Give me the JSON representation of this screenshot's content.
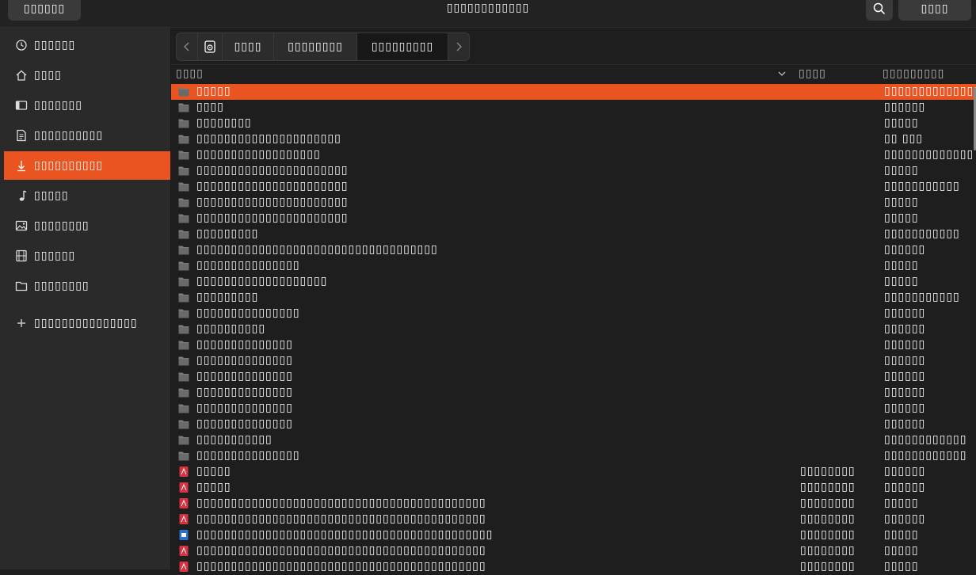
{
  "header": {
    "cancel_label": "▯▯▯▯▯▯",
    "title": "▯▯▯▯▯▯▯▯▯▯▯▯",
    "open_label": "▯▯▯▯",
    "search_icon": "search-icon"
  },
  "sidebar": {
    "items": [
      {
        "label": "▯▯▯▯▯▯",
        "icon": "clock-icon"
      },
      {
        "label": "▯▯▯▯",
        "icon": "home-icon"
      },
      {
        "label": "▯▯▯▯▯▯▯",
        "icon": "desktop-icon"
      },
      {
        "label": "▯▯▯▯▯▯▯▯▯▯",
        "icon": "document-icon"
      },
      {
        "label": "▯▯▯▯▯▯▯▯▯▯",
        "icon": "download-icon",
        "active": true
      },
      {
        "label": "▯▯▯▯▯",
        "icon": "music-icon"
      },
      {
        "label": "▯▯▯▯▯▯▯▯",
        "icon": "picture-icon"
      },
      {
        "label": "▯▯▯▯▯▯",
        "icon": "video-icon"
      },
      {
        "label": "▯▯▯▯▯▯▯▯",
        "icon": "folder-icon"
      }
    ],
    "add_label": "▯▯▯▯▯▯▯▯▯▯▯▯▯▯▯"
  },
  "pathbar": {
    "segments": [
      "▯▯▯▯",
      "▯▯▯▯▯▯▯▯",
      "▯▯▯▯▯▯▯▯▯"
    ]
  },
  "columns": {
    "name": "▯▯▯▯",
    "size": "▯▯▯▯",
    "modified": "▯▯▯▯▯▯▯▯▯"
  },
  "files": [
    {
      "name": "▯▯▯▯▯",
      "size": "",
      "modified": "▯▯▯▯▯▯▯▯▯▯▯▯▯▯",
      "type": "folder"
    },
    {
      "name": "▯▯▯▯",
      "size": "",
      "modified": "▯▯▯▯▯▯",
      "type": "folder"
    },
    {
      "name": "▯▯▯▯▯▯▯▯",
      "size": "",
      "modified": "▯▯▯▯▯",
      "type": "folder"
    },
    {
      "name": "▯▯▯▯▯▯▯▯▯▯▯▯▯▯▯▯▯▯▯▯▯",
      "size": "",
      "modified": "▯▯ ▯▯▯",
      "type": "folder"
    },
    {
      "name": "▯▯▯▯▯▯▯▯▯▯▯▯▯▯▯▯▯▯",
      "size": "",
      "modified": "▯▯▯▯▯▯▯▯▯▯▯▯▯",
      "type": "folder"
    },
    {
      "name": "▯▯▯▯▯▯▯▯▯▯▯▯▯▯▯▯▯▯▯▯▯▯",
      "size": "",
      "modified": "▯▯▯▯▯",
      "type": "folder"
    },
    {
      "name": "▯▯▯▯▯▯▯▯▯▯▯▯▯▯▯▯▯▯▯▯▯▯",
      "size": "",
      "modified": "▯▯▯▯▯▯▯▯▯▯▯",
      "type": "folder"
    },
    {
      "name": "▯▯▯▯▯▯▯▯▯▯▯▯▯▯▯▯▯▯▯▯▯▯",
      "size": "",
      "modified": "▯▯▯▯▯",
      "type": "folder"
    },
    {
      "name": "▯▯▯▯▯▯▯▯▯▯▯▯▯▯▯▯▯▯▯▯▯▯",
      "size": "",
      "modified": "▯▯▯▯▯",
      "type": "folder"
    },
    {
      "name": "▯▯▯▯▯▯▯▯▯",
      "size": "",
      "modified": "▯▯▯▯▯▯▯▯▯▯▯",
      "type": "folder"
    },
    {
      "name": "▯▯▯▯▯▯▯▯▯▯▯▯▯▯▯▯▯▯▯▯▯▯▯▯▯▯▯▯▯▯▯▯▯▯▯",
      "size": "",
      "modified": "▯▯▯▯▯▯",
      "type": "folder"
    },
    {
      "name": "▯▯▯▯▯▯▯▯▯▯▯▯▯▯▯",
      "size": "",
      "modified": "▯▯▯▯▯",
      "type": "folder"
    },
    {
      "name": "▯▯▯▯▯▯▯▯▯▯▯▯▯▯▯▯▯▯▯",
      "size": "",
      "modified": "▯▯▯▯▯",
      "type": "folder"
    },
    {
      "name": "▯▯▯▯▯▯▯▯▯",
      "size": "",
      "modified": "▯▯▯▯▯▯▯▯▯▯▯",
      "type": "folder"
    },
    {
      "name": "▯▯▯▯▯▯▯▯▯▯▯▯▯▯▯",
      "size": "",
      "modified": "▯▯▯▯▯▯",
      "type": "folder"
    },
    {
      "name": "▯▯▯▯▯▯▯▯▯▯",
      "size": "",
      "modified": "▯▯▯▯▯▯",
      "type": "folder"
    },
    {
      "name": "▯▯▯▯▯▯▯▯▯▯▯▯▯▯",
      "size": "",
      "modified": "▯▯▯▯▯▯",
      "type": "folder"
    },
    {
      "name": "▯▯▯▯▯▯▯▯▯▯▯▯▯▯",
      "size": "",
      "modified": "▯▯▯▯▯▯",
      "type": "folder"
    },
    {
      "name": "▯▯▯▯▯▯▯▯▯▯▯▯▯▯",
      "size": "",
      "modified": "▯▯▯▯▯▯",
      "type": "folder"
    },
    {
      "name": "▯▯▯▯▯▯▯▯▯▯▯▯▯▯",
      "size": "",
      "modified": "▯▯▯▯▯▯",
      "type": "folder"
    },
    {
      "name": "▯▯▯▯▯▯▯▯▯▯▯▯▯▯",
      "size": "",
      "modified": "▯▯▯▯▯▯",
      "type": "folder"
    },
    {
      "name": "▯▯▯▯▯▯▯▯▯▯▯▯▯▯",
      "size": "",
      "modified": "▯▯▯▯▯▯",
      "type": "folder"
    },
    {
      "name": "▯▯▯▯▯▯▯▯▯▯▯",
      "size": "",
      "modified": "▯▯▯▯▯▯▯▯▯▯▯▯",
      "type": "folder"
    },
    {
      "name": "▯▯▯▯▯▯▯▯▯▯▯▯▯▯▯",
      "size": "",
      "modified": "▯▯▯▯▯▯▯▯▯▯▯▯",
      "type": "folder"
    },
    {
      "name": "▯▯▯▯▯",
      "size": "▯▯▯▯▯▯▯▯",
      "modified": "▯▯▯▯▯▯",
      "type": "pdf"
    },
    {
      "name": "▯▯▯▯▯",
      "size": "▯▯▯▯▯▯▯▯",
      "modified": "▯▯▯▯▯▯",
      "type": "pdf"
    },
    {
      "name": "▯▯▯▯▯▯▯▯▯▯▯▯▯▯▯▯▯▯▯▯▯▯▯▯▯▯▯▯▯▯▯▯▯▯▯▯▯▯▯▯▯▯",
      "size": "▯▯▯▯▯▯▯▯",
      "modified": "▯▯▯▯▯",
      "type": "pdf"
    },
    {
      "name": "▯▯▯▯▯▯▯▯▯▯▯▯▯▯▯▯▯▯▯▯▯▯▯▯▯▯▯▯▯▯▯▯▯▯▯▯▯▯▯▯▯▯",
      "size": "▯▯▯▯▯▯▯▯",
      "modified": "▯▯▯▯▯▯",
      "type": "pdf"
    },
    {
      "name": "▯▯▯▯▯▯▯▯▯▯▯▯▯▯▯▯▯▯▯▯▯▯▯▯▯▯▯▯▯▯▯▯▯▯▯▯▯▯▯▯▯▯▯",
      "size": "▯▯▯▯▯▯▯▯",
      "modified": "▯▯▯▯▯",
      "type": "doc"
    },
    {
      "name": "▯▯▯▯▯▯▯▯▯▯▯▯▯▯▯▯▯▯▯▯▯▯▯▯▯▯▯▯▯▯▯▯▯▯▯▯▯▯▯▯▯▯",
      "size": "▯▯▯▯▯▯▯▯",
      "modified": "▯▯▯▯▯",
      "type": "pdf"
    },
    {
      "name": "▯▯▯▯▯▯▯▯▯▯▯▯▯▯▯▯▯▯▯▯▯▯▯▯▯▯▯▯▯▯▯▯▯▯▯▯▯▯▯▯▯▯",
      "size": "▯▯▯▯▯▯▯▯",
      "modified": "▯▯▯▯▯",
      "type": "pdf"
    }
  ],
  "colors": {
    "accent": "#e95420",
    "folder": "#7b7b7b",
    "pdf": "#d8313f",
    "doc": "#2f6fd1"
  }
}
